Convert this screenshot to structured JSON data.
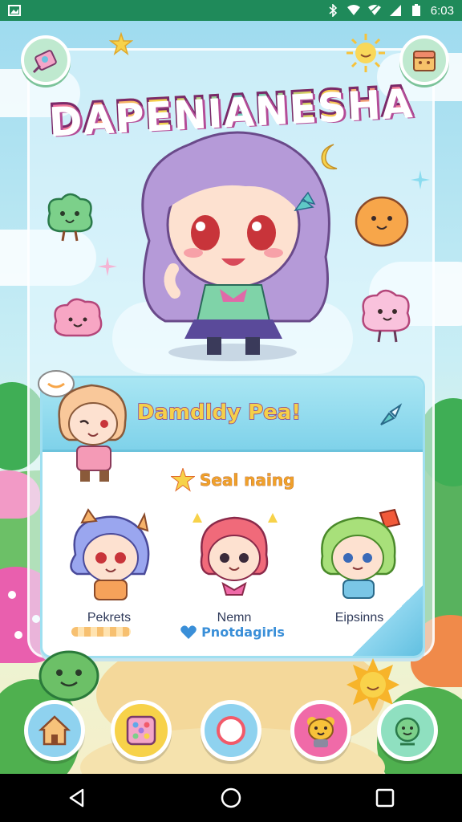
{
  "status_bar": {
    "time": "6:03",
    "icons": [
      "image-icon",
      "bluetooth-icon",
      "wifi-icon",
      "wifi-icon",
      "signal-icon",
      "battery-icon"
    ]
  },
  "game": {
    "title": "DAPENIANESHA",
    "party_card": {
      "header": "Damdldy Pea!",
      "section_label": "Seal naing",
      "members": [
        {
          "name": "Pekrets"
        },
        {
          "name": "Nemn"
        },
        {
          "name": "Eipsinns"
        }
      ],
      "footer": "Pnotdagirls"
    },
    "corner_buttons": [
      "map-icon",
      "shop-icon"
    ],
    "bottom_nav": [
      "home-icon",
      "inventory-icon",
      "compass-icon",
      "pet-icon",
      "friends-icon"
    ]
  },
  "colors": {
    "status_bar": "#1f8a5a",
    "title_pink": "#f06aa8",
    "title_yellow": "#f7d24a",
    "title_teal": "#5fc9c6",
    "card_header": "#7fd2ea",
    "accent_blue": "#3a8fd8"
  },
  "android_nav": [
    "back-icon",
    "home-circle-icon",
    "recents-icon"
  ]
}
